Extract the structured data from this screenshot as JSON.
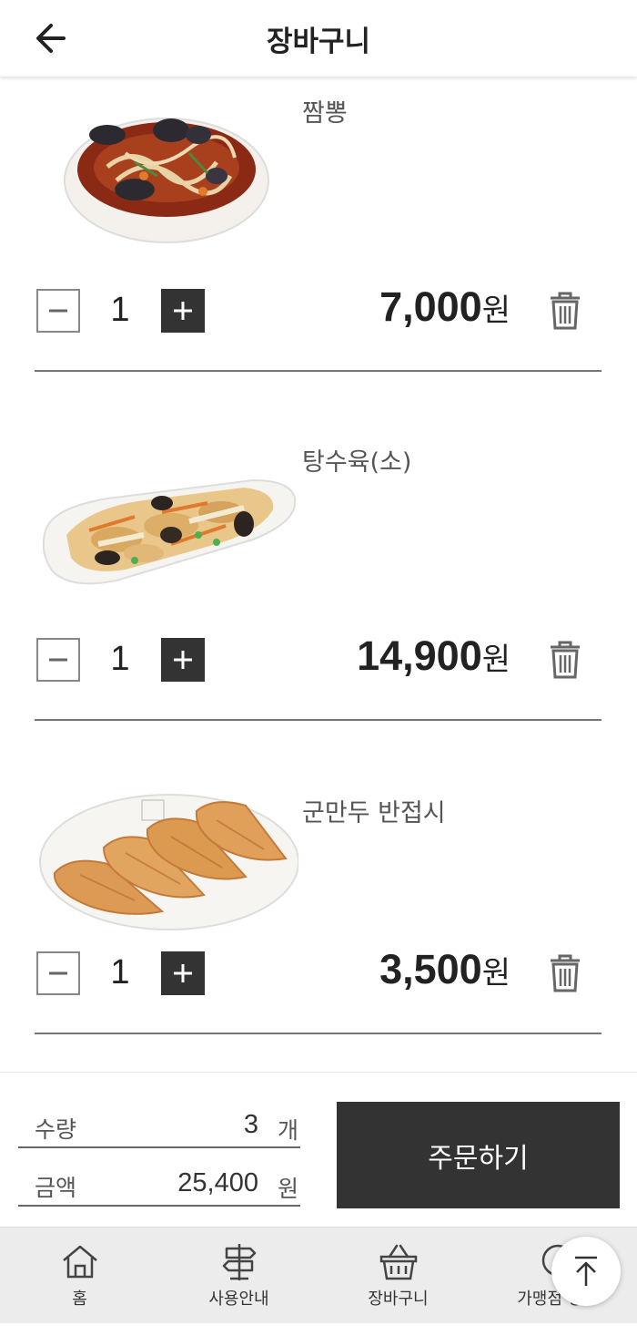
{
  "header": {
    "title": "장바구니",
    "back_icon": "arrow-left-icon"
  },
  "cart": {
    "items": [
      {
        "name": "짬뽕",
        "quantity": "1",
        "price": "7,000",
        "price_unit": "원",
        "image": "jjamppong-noodle-soup"
      },
      {
        "name": "탕수육(소)",
        "quantity": "1",
        "price": "14,900",
        "price_unit": "원",
        "image": "sweet-sour-pork"
      },
      {
        "name": "군만두 반접시",
        "quantity": "1",
        "price": "3,500",
        "price_unit": "원",
        "image": "fried-dumplings"
      }
    ]
  },
  "summary": {
    "quantity_label": "수량",
    "quantity_value": "3",
    "quantity_unit": "개",
    "amount_label": "금액",
    "amount_value": "25,400",
    "amount_unit": "원",
    "order_button": "주문하기"
  },
  "nav": {
    "items": [
      {
        "label": "홈",
        "icon": "home-icon"
      },
      {
        "label": "사용안내",
        "icon": "signpost-icon"
      },
      {
        "label": "장바구니",
        "icon": "basket-icon"
      },
      {
        "label": "가맹점 정보",
        "icon": "store-info-icon"
      }
    ]
  },
  "colors": {
    "dark": "#333333",
    "nav_bg": "#ececec",
    "divider": "#777777"
  }
}
